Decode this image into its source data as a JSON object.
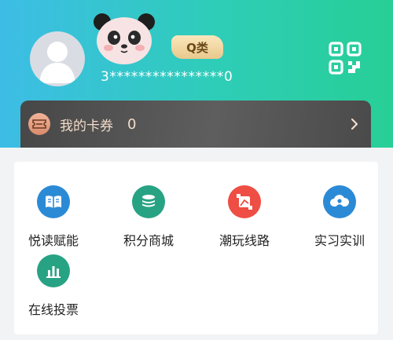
{
  "header": {
    "badge_label": "Q类",
    "phone_masked": "3****************0",
    "avatar_icon": "user-avatar-icon",
    "decor_icon": "panda-icon",
    "qr_icon": "qr-code-icon"
  },
  "card": {
    "label": "我的卡券",
    "count": "0",
    "icon": "ticket-icon",
    "arrow_icon": "chevron-right-icon"
  },
  "menu": {
    "items": [
      {
        "label": "悦读赋能",
        "icon": "book-icon",
        "color": "#2b8ad6"
      },
      {
        "label": "积分商城",
        "icon": "coins-stack-icon",
        "color": "#27a383"
      },
      {
        "label": "潮玩线路",
        "icon": "route-icon",
        "color": "#ee4e43"
      },
      {
        "label": "实习实训",
        "icon": "cloud-user-icon",
        "color": "#2b8ad6"
      },
      {
        "label": "在线投票",
        "icon": "bar-chart-icon",
        "color": "#27a383"
      }
    ]
  },
  "colors": {
    "header_gradient_start": "#3dbde6",
    "header_gradient_end": "#27cf95",
    "card_background": "#4a4a4a",
    "card_text": "#f3dcc9",
    "badge_gold": "#e8c98c"
  }
}
